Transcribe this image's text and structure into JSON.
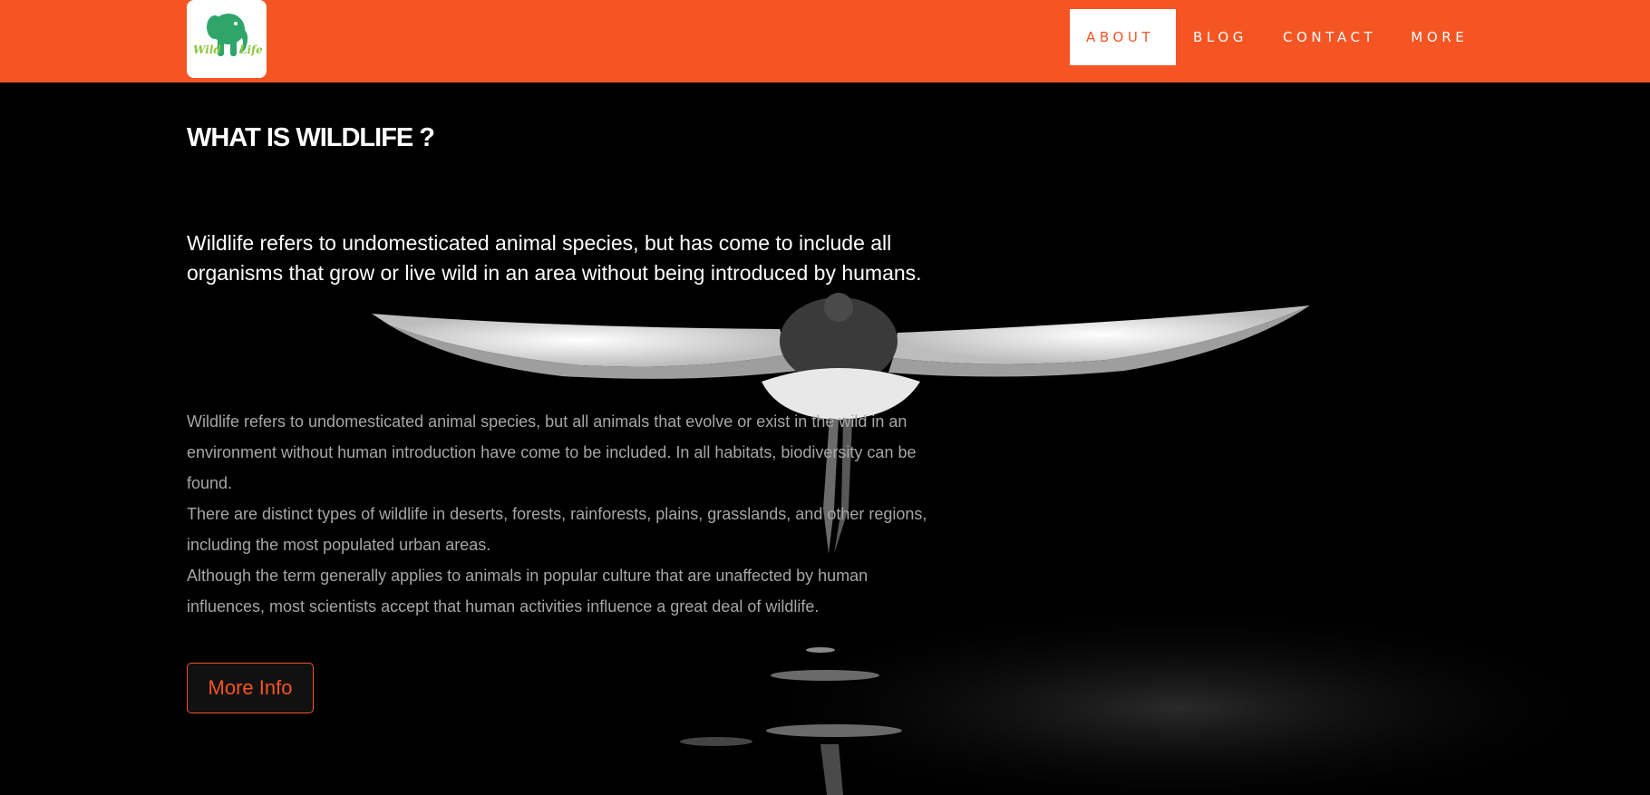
{
  "header": {
    "logo": {
      "icon": "elephant-icon",
      "text_left": "Wild",
      "text_right": "Life"
    },
    "nav": [
      {
        "label": "ABOUT",
        "active": true
      },
      {
        "label": "BLOG",
        "active": false
      },
      {
        "label": "CONTACT",
        "active": false
      },
      {
        "label": "MORE",
        "active": false
      }
    ]
  },
  "main": {
    "title": "WHAT IS WILDLIFE ?",
    "lead": "Wildlife refers to undomesticated animal species, but has come to include all organisms that grow or live wild in an area without being introduced by humans.",
    "paragraphs": [
      "Wildlife refers to undomesticated animal species, but all animals that evolve or exist in the wild in an environment without human introduction have come to be included. In all habitats, biodiversity can be found.",
      "There are distinct types of wildlife in deserts, forests, rainforests, plains, grasslands, and other regions, including the most populated urban areas.",
      "Although the term generally applies to animals in popular culture that are unaffected by human influences, most scientists accept that human activities influence a great deal of wildlife."
    ],
    "more_button": "More Info"
  },
  "colors": {
    "accent": "#f45523",
    "background": "#000000",
    "text": "#ffffff",
    "muted_text": "#a6a6a6"
  }
}
